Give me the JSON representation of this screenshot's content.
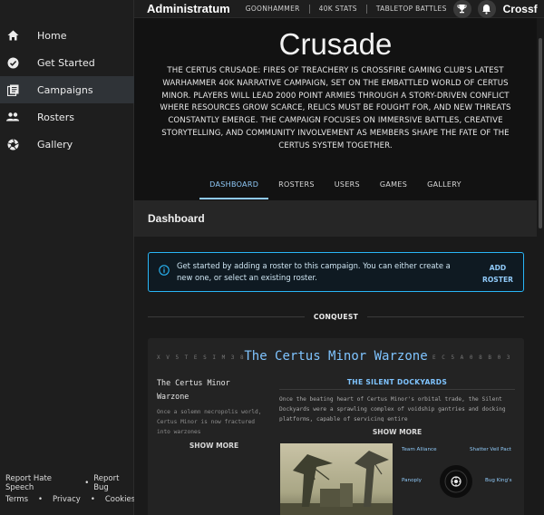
{
  "topbar": {
    "brand": "Administratum",
    "links": [
      "GOONHAMMER",
      "40K STATS",
      "TABLETOP BATTLES"
    ],
    "user_truncated": "Crossf",
    "icons": [
      "trophy-icon",
      "bell-icon"
    ]
  },
  "sidebar": {
    "items": [
      {
        "label": "Home",
        "icon": "home-icon",
        "active": false
      },
      {
        "label": "Get Started",
        "icon": "check-circle-icon",
        "active": false
      },
      {
        "label": "Campaigns",
        "icon": "campaigns-icon",
        "active": true
      },
      {
        "label": "Rosters",
        "icon": "people-icon",
        "active": false
      },
      {
        "label": "Gallery",
        "icon": "aperture-icon",
        "active": false
      }
    ],
    "footer": {
      "report_hate": "Report Hate Speech",
      "report_bug": "Report Bug",
      "terms": "Terms",
      "privacy": "Privacy",
      "cookies": "Cookies",
      "dot": "•"
    }
  },
  "hero": {
    "title": "Crusade",
    "description": "THE CERTUS CRUSADE: FIRES OF TREACHERY IS CROSSFIRE GAMING CLUB'S LATEST WARHAMMER 40K NARRATIVE CAMPAIGN, SET ON THE EMBATTLED WORLD OF CERTUS MINOR. PLAYERS WILL LEAD 2000 POINT ARMIES THROUGH A STORY-DRIVEN CONFLICT WHERE RESOURCES GROW SCARCE, RELICS MUST BE FOUGHT FOR, AND NEW THREATS CONSTANTLY EMERGE. THE CAMPAIGN FOCUSES ON IMMERSIVE BATTLES, CREATIVE STORYTELLING, AND COMMUNITY INVOLVEMENT AS MEMBERS SHAPE THE FATE OF THE CERTUS SYSTEM TOGETHER."
  },
  "tabs": [
    {
      "label": "DASHBOARD",
      "active": true
    },
    {
      "label": "ROSTERS",
      "active": false
    },
    {
      "label": "USERS",
      "active": false
    },
    {
      "label": "GAMES",
      "active": false
    },
    {
      "label": "GALLERY",
      "active": false
    }
  ],
  "dashboard": {
    "heading": "Dashboard",
    "alert": {
      "text": "Get started by adding a roster to this campaign. You can either create a new one, or select an existing roster.",
      "action_line1": "ADD",
      "action_line2": "ROSTER"
    },
    "section_label": "CONQUEST",
    "card": {
      "cipher_left": "X V 5 T E S I M 3 8",
      "title": "The Certus Minor Warzone",
      "cipher_right": "E C 5 A 0 8 B 0 3",
      "left_title": "The Certus Minor Warzone",
      "left_desc": "Once a solemn necropolis world, Certus Minor is now fractured into warzones",
      "left_show_more": "SHOW MORE",
      "right_title": "THE SILENT DOCKYARDS",
      "right_desc": "Once the beating heart of Certus Minor's orbital trade, the Silent Dockyards were a sprawling complex of voidship gantries and docking platforms, capable of servicing entire",
      "right_show_more": "SHOW MORE",
      "factions": [
        "Team Alliance",
        "Shatter Veil Pact",
        "Panoply",
        "Bug King's"
      ]
    }
  },
  "colors": {
    "accent": "#90caf9",
    "alert_border": "#29b6f6",
    "sidebar_bg": "#1e1e1e",
    "page_bg": "#121212"
  }
}
